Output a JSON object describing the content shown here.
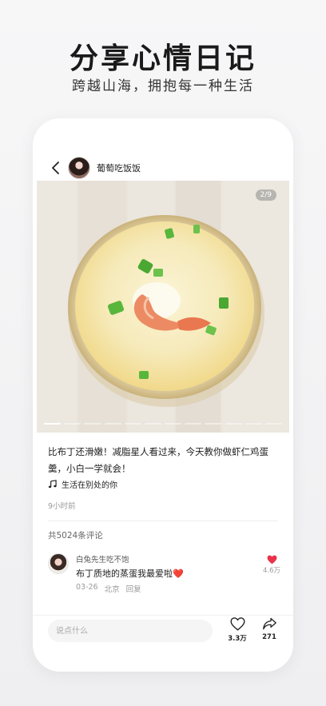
{
  "promo": {
    "title": "分享心情日记",
    "subtitle": "跨越山海，拥抱每一种生活"
  },
  "post": {
    "author": "葡萄吃饭饭",
    "image_counter": "2/9",
    "caption": "比布丁还滑嫩！减脂星人看过来，今天教你做虾仁鸡蛋羹，小白一学就会！",
    "music": "生活在别处的你",
    "time": "9小时前",
    "image_count": 9,
    "current_image": 1
  },
  "comments": {
    "count_label": "共5024条评论",
    "items": [
      {
        "user": "白兔先生吃不饱",
        "text": "布丁质地的蒸蛋我最爱啦",
        "emoji": "❤️",
        "date": "03-26",
        "location": "北京",
        "reply_label": "回复",
        "likes": "4.6万"
      }
    ]
  },
  "bottom_bar": {
    "input_placeholder": "说点什么",
    "likes": "3.3万",
    "shares": "271"
  },
  "colors": {
    "accent_red": "#e8334a",
    "text_primary": "#222222",
    "text_muted": "#9a9a9a"
  }
}
